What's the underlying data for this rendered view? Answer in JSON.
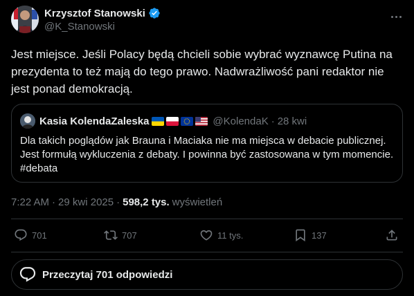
{
  "tweet": {
    "author_name": "Krzysztof Stanowski",
    "author_handle": "@K_Stanowski",
    "text": "Jest miejsce. Jeśli Polacy będą chcieli sobie wybrać wyznawcę Putina na prezydenta to też mają do tego prawo. Nadwrażliwość pani redaktor nie jest ponad demokracją.",
    "time": "7:22 AM",
    "date": "29 kwi 2025",
    "views_count": "598,2 tys.",
    "views_label": "wyświetleń"
  },
  "quote": {
    "author_name": "Kasia KolendaZaleska",
    "author_handle": "@KolendaK",
    "time": "28 kwi",
    "flags": [
      "ukraine-flag",
      "poland-flag",
      "eu-flag",
      "usa-flag"
    ],
    "text": "Dla takich poglądów jak Brauna i Maciaka nie ma miejsca w debacie publicznej. Jest formułą wykluczenia z debaty. I powinna być zastosowana w tym momencie. #debata"
  },
  "actions": {
    "replies": "701",
    "reposts": "707",
    "likes": "11 tys.",
    "bookmarks": "137"
  },
  "read_replies_label": "Przeczytaj 701 odpowiedzi",
  "colors": {
    "background": "#000000",
    "text": "#e7e9ea",
    "secondary": "#71767b",
    "border": "#2f3336",
    "verified": "#1d9bf0"
  }
}
